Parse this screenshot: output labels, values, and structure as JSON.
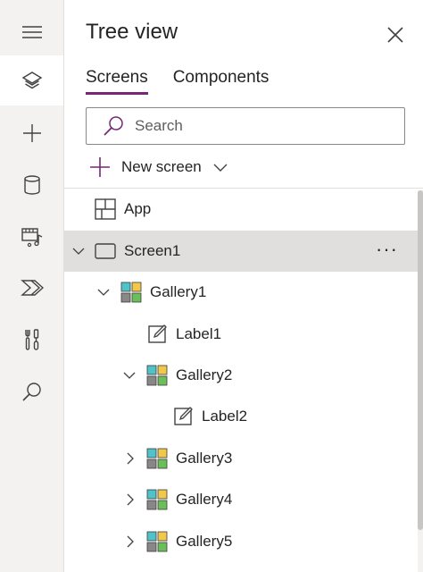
{
  "rail": {
    "items": [
      {
        "icon": "layers-icon",
        "active": true
      },
      {
        "icon": "plus-icon",
        "active": false
      },
      {
        "icon": "database-icon",
        "active": false
      },
      {
        "icon": "media-icon",
        "active": false
      },
      {
        "icon": "power-automate-icon",
        "active": false
      },
      {
        "icon": "tools-icon",
        "active": false
      },
      {
        "icon": "search-icon",
        "active": false
      }
    ]
  },
  "panel": {
    "title": "Tree view",
    "tabs": [
      {
        "label": "Screens",
        "active": true
      },
      {
        "label": "Components",
        "active": false
      }
    ],
    "search_placeholder": "Search",
    "new_screen_label": "New screen"
  },
  "tree": {
    "app": {
      "label": "App"
    },
    "screen1": {
      "label": "Screen1",
      "more": "···"
    },
    "gallery1": {
      "label": "Gallery1"
    },
    "label1": {
      "label": "Label1"
    },
    "gallery2": {
      "label": "Gallery2"
    },
    "label2": {
      "label": "Label2"
    },
    "gallery3": {
      "label": "Gallery3"
    },
    "gallery4": {
      "label": "Gallery4"
    },
    "gallery5": {
      "label": "Gallery5"
    }
  },
  "colors": {
    "accent": "#742774",
    "selected_row": "#e1dfdd",
    "rail_bg": "#f3f2f1",
    "gallery_teal": "#4fc3c7",
    "gallery_yellow": "#f2c84b",
    "gallery_gray": "#8a8886",
    "gallery_green": "#6bbf59"
  }
}
